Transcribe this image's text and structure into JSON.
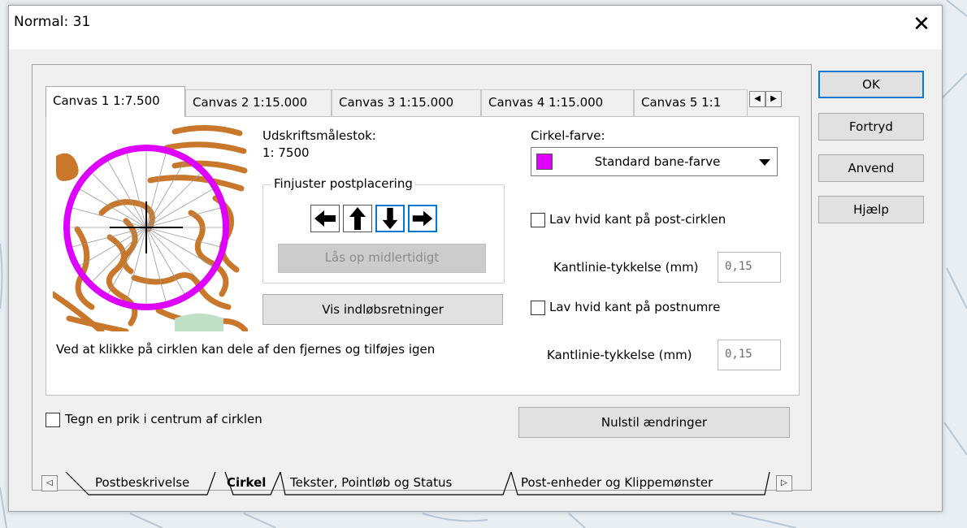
{
  "window": {
    "title": "Normal: 31",
    "close_glyph": "✕"
  },
  "side_buttons": {
    "ok": "OK",
    "cancel": "Fortryd",
    "apply": "Anvend",
    "help": "Hjælp"
  },
  "canvas_tabs": {
    "items": [
      "Canvas 1 1:7.500",
      "Canvas 2 1:15.000",
      "Canvas 3 1:15.000",
      "Canvas 4 1:15.000",
      "Canvas 5 1:1"
    ],
    "active_index": 0,
    "scroll_left": "◀",
    "scroll_right": "▶"
  },
  "scale": {
    "label": "Udskriftsmålestok:",
    "value": "1: 7500"
  },
  "fine_adjust": {
    "title": "Finjuster postplacering",
    "arrows": [
      "arrow-left-icon",
      "arrow-up-icon",
      "arrow-down-icon",
      "arrow-right-icon"
    ],
    "unlock_button": "Lås op midlertidigt"
  },
  "show_directions_button": "Vis indløbsretninger",
  "hint_text": "Ved at klikke på cirklen kan dele af den fjernes og tilføjes igen",
  "circle_color": {
    "label": "Cirkel-farve:",
    "selected": "Standard bane-farve",
    "swatch": "#dd00ff"
  },
  "white_edge_circle": {
    "label": "Lav hvid kant på post-cirklen",
    "checked": false,
    "thickness_label": "Kantlinie-tykkelse (mm)",
    "thickness_value": "0,15"
  },
  "white_edge_numbers": {
    "label": "Lav hvid kant på postnumre",
    "checked": false,
    "thickness_label": "Kantlinie-tykkelse (mm)",
    "thickness_value": "0,15"
  },
  "center_dot": {
    "label": "Tegn en prik i centrum af cirklen",
    "checked": false
  },
  "reset_button": "Nulstil ændringer",
  "bottom_tabs": {
    "items": [
      "Postbeskrivelse",
      "Cirkel",
      "Tekster, Pointløb og Status",
      "Post-enheder og Klippemønster"
    ],
    "active_index": 1,
    "scroll_left": "◁",
    "scroll_right": "▷"
  },
  "colors": {
    "accent": "#0078d7",
    "contour": "#c8772b",
    "circle": "#dd00ff"
  }
}
